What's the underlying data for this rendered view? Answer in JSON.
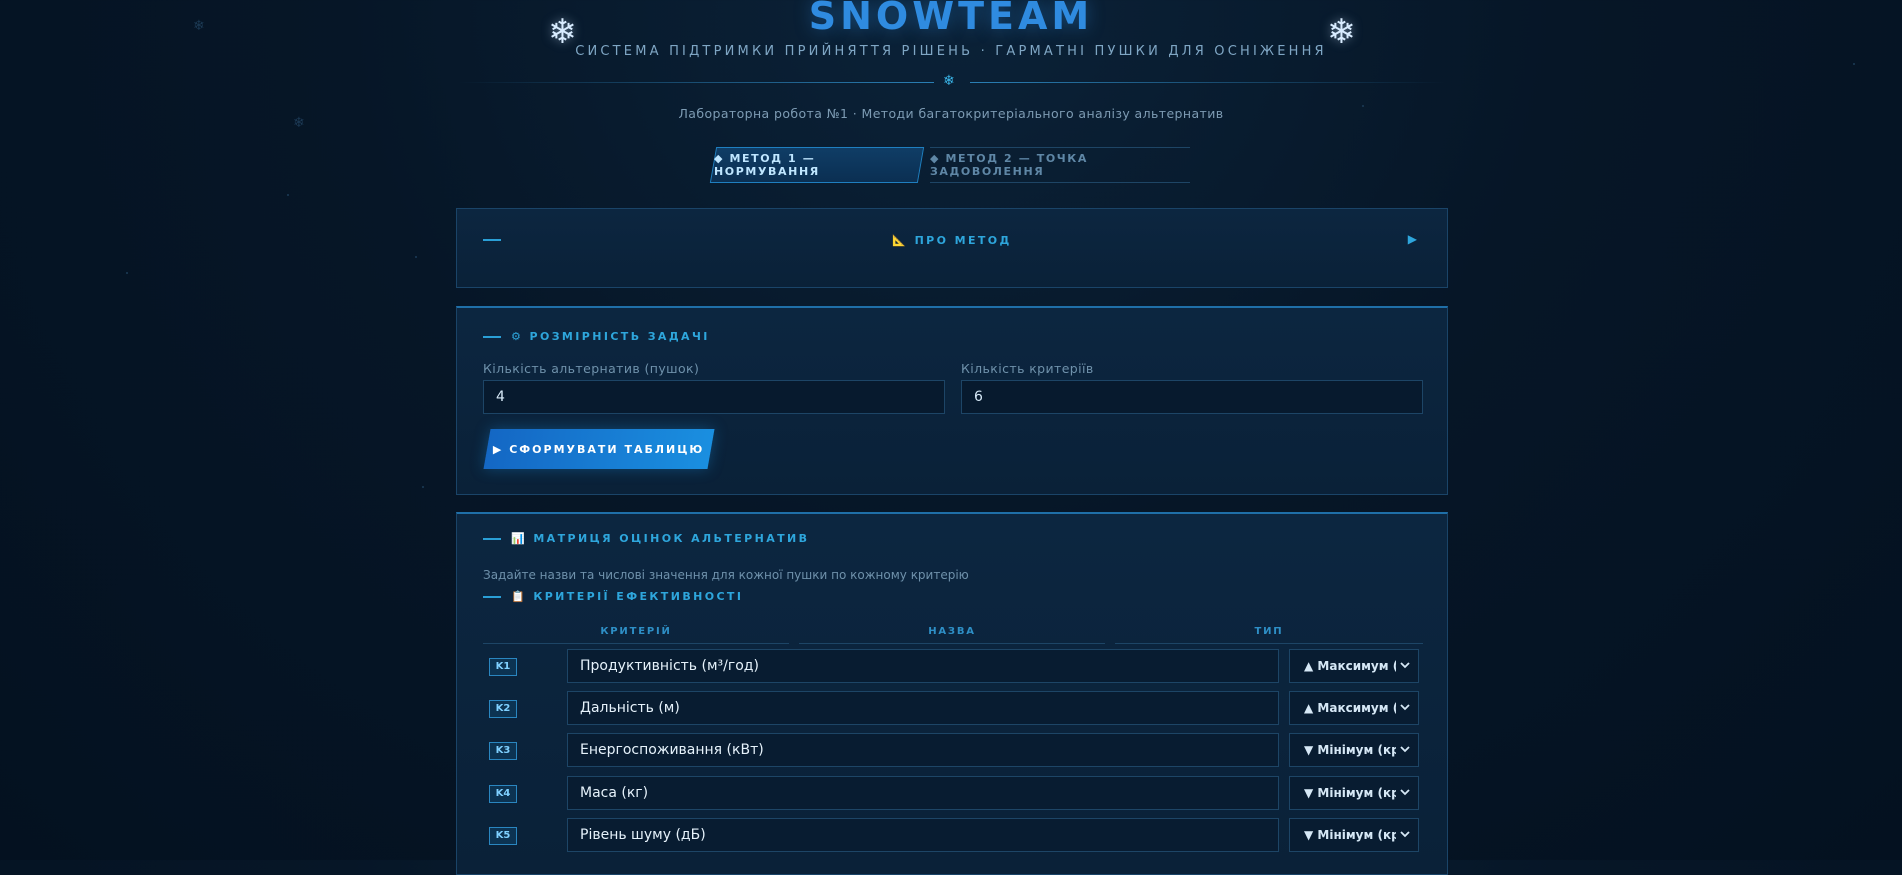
{
  "app": {
    "title": "SNOWTEAM",
    "subtitle": "СИСТЕМА ПІДТРИМКИ ПРИЙНЯТТЯ РІШЕНЬ · ГАРМАТНІ ПУШКИ ДЛЯ ОСНІЖЕННЯ",
    "lab_caption": "Лабораторна робота №1 · Методи багатокритеріального аналізу альтернатив"
  },
  "tabs": [
    {
      "label": "◆ МЕТОД 1 — НОРМУВАННЯ",
      "active": true
    },
    {
      "label": "◆ МЕТОД 2 — ТОЧКА ЗАДОВОЛЕННЯ",
      "active": false
    }
  ],
  "about": {
    "label": "📐 ПРО МЕТОД"
  },
  "dims": {
    "title": "⚙ РОЗМІРНІСТЬ ЗАДАЧІ",
    "alternatives": {
      "label": "Кількість альтернатив (пушок)",
      "value": "4"
    },
    "criteria": {
      "label": "Кількість критеріїв",
      "value": "6"
    },
    "button": "▶ СФОРМУВАТИ ТАБЛИЦЮ"
  },
  "matrix": {
    "title": "📊 МАТРИЦЯ ОЦІНОК АЛЬТЕРНАТИВ",
    "hint": "Задайте назви та числові значення для кожної пушки по кожному критерію",
    "criteria_title": "📋 КРИТЕРІЇ ЕФЕКТИВНОСТІ",
    "columns": [
      "КРИТЕРІЙ",
      "НАЗВА",
      "ТИП"
    ],
    "rows": [
      {
        "id": "K1",
        "name": "Продуктивність (м³/год)",
        "type": "▲ Максимум (кращ"
      },
      {
        "id": "K2",
        "name": "Дальність (м)",
        "type": "▲ Максимум (кращ"
      },
      {
        "id": "K3",
        "name": "Енергоспоживання (кВт)",
        "type": "▼ Мінімум (кращ"
      },
      {
        "id": "K4",
        "name": "Маса (кг)",
        "type": "▼ Мінімум (кращ"
      },
      {
        "id": "K5",
        "name": "Рівень шуму (дБ)",
        "type": "▼ Мінімум (кращ"
      }
    ]
  },
  "colors": {
    "accent": "#2ea6dc",
    "title": "#2f8be0",
    "button": "#1a8fe0"
  },
  "icons": {
    "decor": "snowflake-icon",
    "about_toggle": "play-arrow-icon",
    "select": "chevron-down-icon"
  }
}
